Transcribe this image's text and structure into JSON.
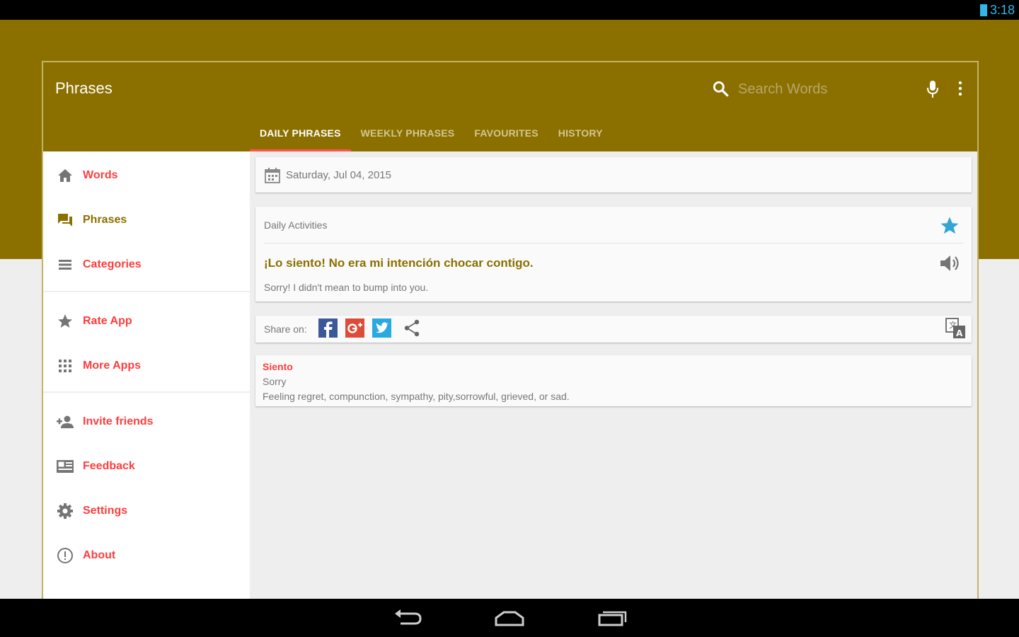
{
  "status_bar": {
    "time": "3:18"
  },
  "colors": {
    "brand": "#8b7000",
    "accent": "#ff3d3d",
    "star": "#33a5d6"
  },
  "appbar": {
    "title": "Phrases",
    "search_placeholder": "Search Words",
    "tabs": [
      {
        "label": "DAILY PHRASES",
        "active": true
      },
      {
        "label": "WEEKLY PHRASES",
        "active": false
      },
      {
        "label": "FAVOURITES",
        "active": false
      },
      {
        "label": "HISTORY",
        "active": false
      }
    ]
  },
  "sidebar": {
    "items": [
      {
        "label": "Words",
        "icon": "home-icon"
      },
      {
        "label": "Phrases",
        "icon": "forum-icon",
        "selected": true
      },
      {
        "label": "Categories",
        "icon": "list-icon"
      },
      {
        "label": "Rate App",
        "icon": "star-icon"
      },
      {
        "label": "More Apps",
        "icon": "apps-grid-icon"
      },
      {
        "label": "Invite friends",
        "icon": "person-add-icon"
      },
      {
        "label": "Feedback",
        "icon": "feedback-icon"
      },
      {
        "label": "Settings",
        "icon": "gear-icon"
      },
      {
        "label": "About",
        "icon": "info-icon"
      }
    ]
  },
  "content": {
    "date": "Saturday, Jul 04, 2015",
    "phrase_card": {
      "category": "Daily Activities",
      "phrase": "¡Lo siento! No era mi intención chocar contigo.",
      "translation": "Sorry! I didn't mean to bump into you."
    },
    "share": {
      "label": "Share on:"
    },
    "word_card": {
      "word": "Siento",
      "translation": "Sorry",
      "definition": "Feeling regret, compunction, sympathy, pity,sorrowful, grieved, or sad."
    }
  }
}
